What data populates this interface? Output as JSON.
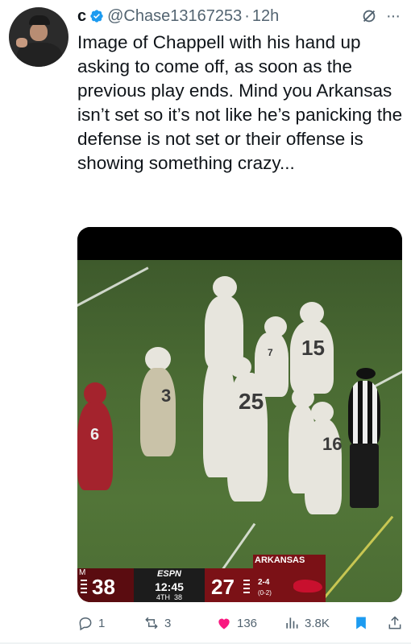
{
  "tweet": {
    "name": "c",
    "handle": "@Chase13167253",
    "separator": "·",
    "time": "12h",
    "text": "Image of Chappell with his hand up asking to come off, as soon as the previous play ends. Mind you Arkansas isn’t set so it’s not like he’s panicking the defense is not set or their offense is showing something crazy..."
  },
  "scoreboard": {
    "left_marker": "M",
    "score_left": "38",
    "network": "ESPN",
    "clock": "12:45",
    "quarter": "4TH",
    "play_clock": "38",
    "team_right": "ARKANSAS",
    "score_right": "27",
    "record": "2-4",
    "conf_record": "(0-2)"
  },
  "jerseys": {
    "a": "15",
    "b": "25",
    "c": "3",
    "d": "16",
    "e": "6",
    "f": "7"
  },
  "actions": {
    "replies": "1",
    "reposts": "3",
    "likes": "136",
    "views": "3.8K"
  },
  "colors": {
    "like": "#f91880",
    "verified": "#1d9bf0",
    "bookmark": "#1d9bf0",
    "muted": "#536471"
  }
}
